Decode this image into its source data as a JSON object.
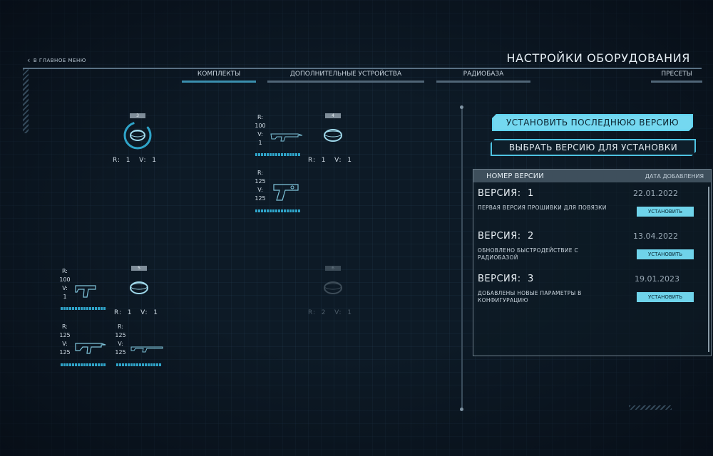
{
  "header": {
    "back_label": "В ГЛАВНОЕ МЕНЮ",
    "title": "НАСТРОЙКИ ОБОРУДОВАНИЯ"
  },
  "tabs": [
    {
      "label": "КОМПЛЕКТЫ",
      "active": true
    },
    {
      "label": "ДОПОЛНИТЕЛЬНЫЕ УСТРОЙСТВА",
      "active": false
    },
    {
      "label": "РАДИОБАЗА",
      "active": false
    },
    {
      "label": "ПРЕСЕТЫ",
      "active": false
    }
  ],
  "kits": {
    "k3": {
      "number": "3",
      "r_label": "R:",
      "r": "1",
      "v_label": "V:",
      "v": "1"
    },
    "k4": {
      "number": "4",
      "r_label": "R:",
      "r": "1",
      "v_label": "V:",
      "v": "1",
      "devices": [
        {
          "r_label": "R:",
          "r": "100",
          "v_label": "V:",
          "v": "1",
          "icon": "smg-icon"
        },
        {
          "r_label": "R:",
          "r": "125",
          "v_label": "V:",
          "v": "125",
          "icon": "pistol-icon"
        }
      ]
    },
    "k5": {
      "number": "5",
      "r_label": "R:",
      "r": "1",
      "v_label": "V:",
      "v": "1",
      "devices": [
        {
          "r_label": "R:",
          "r": "100",
          "v_label": "V:",
          "v": "1",
          "icon": "uzi-icon"
        },
        {
          "r_label": "R:",
          "r": "125",
          "v_label": "V:",
          "v": "125",
          "icon": "rifle-icon"
        },
        {
          "r_label": "R:",
          "r": "125",
          "v_label": "V:",
          "v": "125",
          "icon": "sniper-icon"
        }
      ]
    },
    "k6": {
      "number": "6",
      "r_label": "R:",
      "r": "2",
      "v_label": "V:",
      "v": "1"
    }
  },
  "actions": {
    "install_latest": "УСТАНОВИТЬ ПОСЛЕДНЮЮ ВЕРСИЮ",
    "choose_version": "ВЫБРАТЬ ВЕРСИЮ ДЛЯ УСТАНОВКИ"
  },
  "versions": {
    "col_version": "НОМЕР ВЕРСИИ",
    "col_date": "ДАТА ДОБАВЛЕНИЯ",
    "install_label": "УСТАНОВИТЬ",
    "items": [
      {
        "label": "ВЕРСИЯ:",
        "number": "1",
        "date": "22.01.2022",
        "desc": "ПЕРВАЯ ВЕРСИЯ ПРОШИВКИ ДЛЯ ПОВЯЗКИ"
      },
      {
        "label": "ВЕРСИЯ:",
        "number": "2",
        "date": "13.04.2022",
        "desc": "ОБНОВЛЕНО БЫСТРОДЕЙСТВИЕ С РАДИОБАЗОЙ"
      },
      {
        "label": "ВЕРСИЯ:",
        "number": "3",
        "date": "19.01.2023",
        "desc": "ДОБАВЛЕНЫ НОВЫЕ ПАРАМЕТРЫ В КОНФИГУРАЦИЮ"
      }
    ]
  },
  "colors": {
    "accent": "#74d8f0",
    "bg": "#0d1a26",
    "bar": "#2fa4c9"
  }
}
